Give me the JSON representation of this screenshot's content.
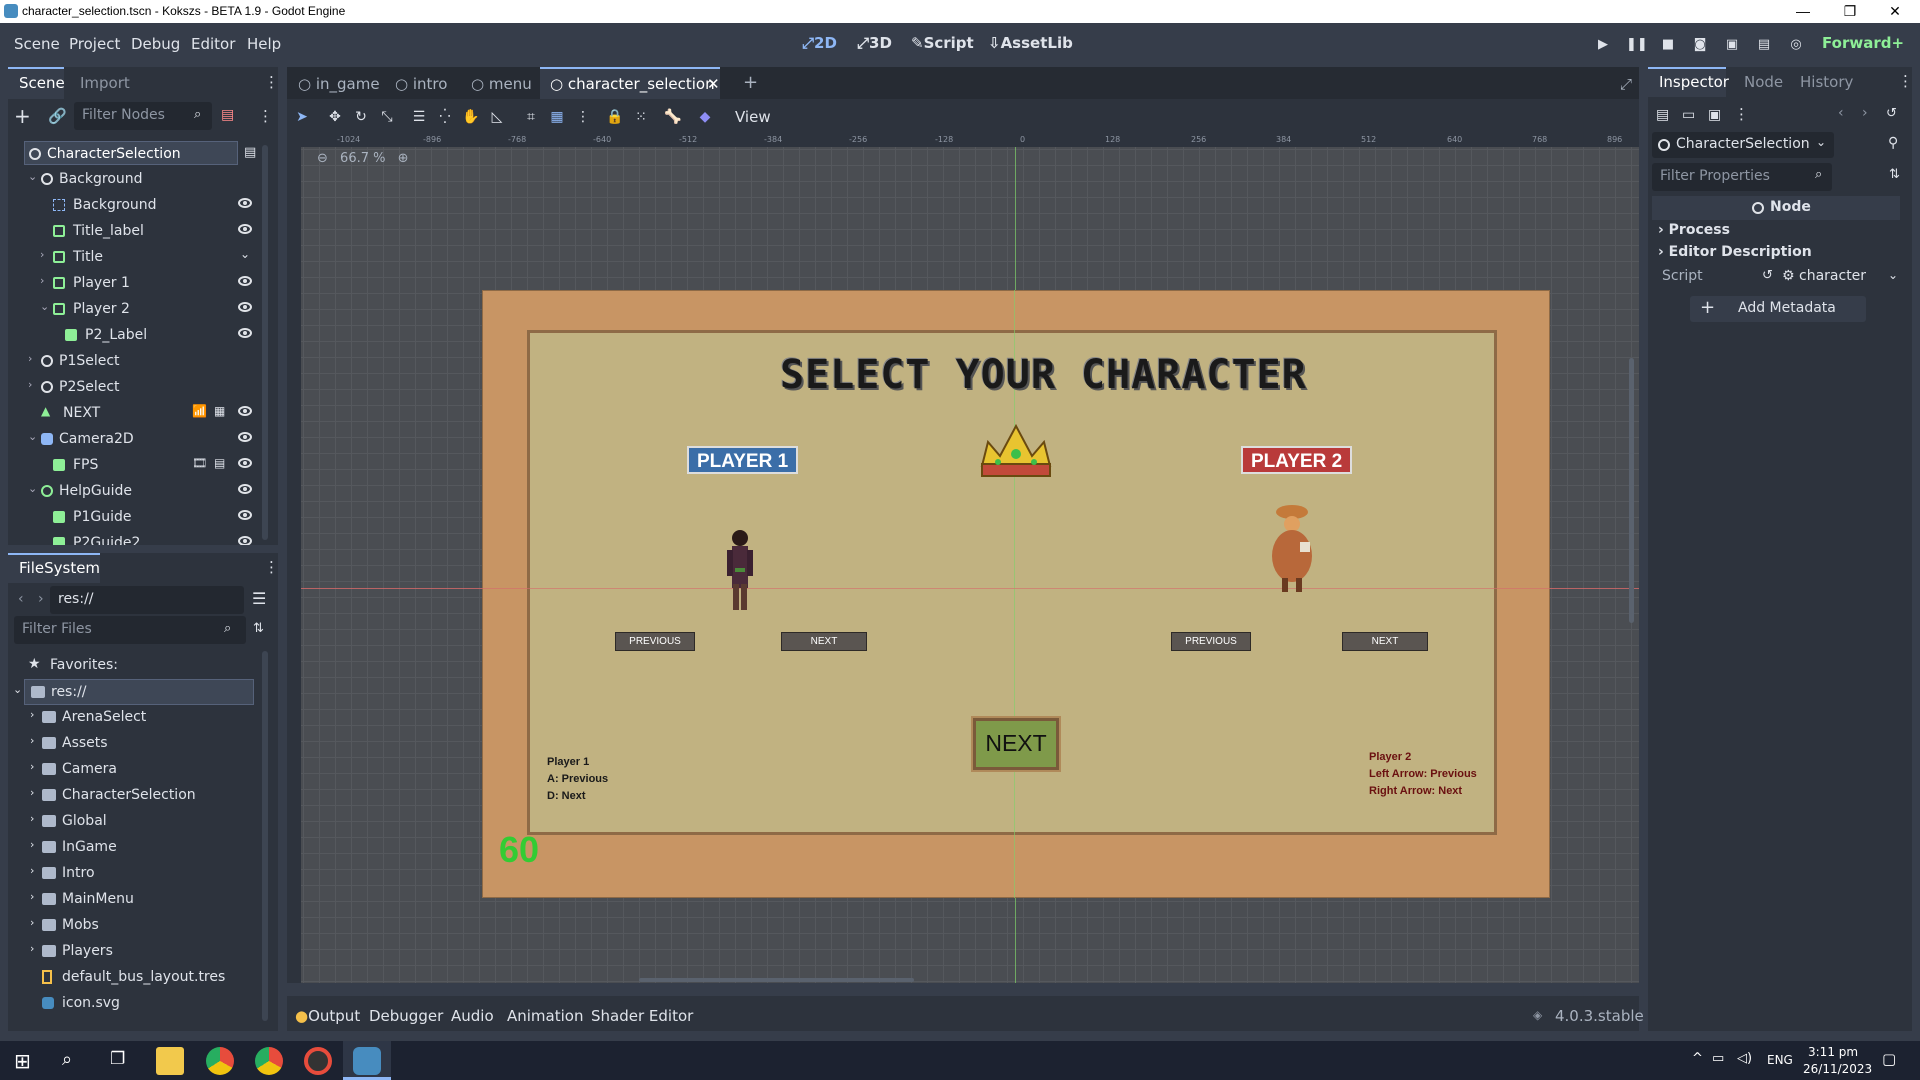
{
  "window": {
    "title": "character_selection.tscn - Kokszs - BETA 1.9 - Godot Engine"
  },
  "menu": [
    "Scene",
    "Project",
    "Debug",
    "Editor",
    "Help"
  ],
  "workspaces": {
    "w2d": "2D",
    "w3d": "3D",
    "script": "Script",
    "assetlib": "AssetLib"
  },
  "renderer": "Forward+",
  "scene_dock": {
    "tabs": [
      "Scene",
      "Import"
    ],
    "filter_placeholder": "Filter Nodes",
    "nodes": [
      {
        "label": "CharacterSelection"
      },
      {
        "label": "Background"
      },
      {
        "label": "Background"
      },
      {
        "label": "Title_label"
      },
      {
        "label": "Title"
      },
      {
        "label": "Player 1"
      },
      {
        "label": "Player 2"
      },
      {
        "label": "P2_Label"
      },
      {
        "label": "P1Select"
      },
      {
        "label": "P2Select"
      },
      {
        "label": "NEXT"
      },
      {
        "label": "Camera2D"
      },
      {
        "label": "FPS"
      },
      {
        "label": "HelpGuide"
      },
      {
        "label": "P1Guide"
      },
      {
        "label": "P2Guide2"
      }
    ]
  },
  "filesystem": {
    "tab": "FileSystem",
    "path": "res://",
    "filter_placeholder": "Filter Files",
    "favorites": "Favorites:",
    "root": "res://",
    "items": [
      "ArenaSelect",
      "Assets",
      "Camera",
      "CharacterSelection",
      "Global",
      "InGame",
      "Intro",
      "MainMenu",
      "Mobs",
      "Players",
      "default_bus_layout.tres",
      "icon.svg"
    ]
  },
  "editor_tabs": [
    "in_game",
    "intro",
    "menu",
    "character_selection"
  ],
  "toolbar": {
    "view": "View",
    "zoom": "66.7 %"
  },
  "ruler_labels": [
    "-1024",
    "-896",
    "-768",
    "-640",
    "-512",
    "-384",
    "-256",
    "-128",
    "0",
    "128",
    "256",
    "384",
    "512",
    "640",
    "768",
    "896"
  ],
  "game": {
    "title": "SELECT YOUR CHARACTER",
    "player1": "PLAYER 1",
    "player2": "PLAYER 2",
    "previous": "PREVIOUS",
    "next_small": "NEXT",
    "next_big": "NEXT",
    "p1_guide": [
      "Player 1",
      "A: Previous",
      "D: Next"
    ],
    "p2_guide": [
      "Player 2",
      "Left Arrow: Previous",
      "Right Arrow: Next"
    ],
    "fps": "60"
  },
  "inspector": {
    "tabs": [
      "Inspector",
      "Node",
      "History"
    ],
    "object": "CharacterSelection",
    "filter_placeholder": "Filter Properties",
    "section": "Node",
    "groups": [
      "Process",
      "Editor Description"
    ],
    "script_label": "Script",
    "script_value": "character",
    "add_metadata": "Add Metadata"
  },
  "bottom": {
    "tabs": [
      "Output",
      "Debugger",
      "Audio",
      "Animation",
      "Shader Editor"
    ],
    "version": "4.0.3.stable"
  },
  "taskbar": {
    "lang": "ENG",
    "time": "3:11 pm",
    "date": "26/11/2023"
  },
  "colors": {
    "accent": "#8eb7f5",
    "player1": "#3b6ea8",
    "player2": "#b93a3a",
    "fps": "#33cc33"
  }
}
